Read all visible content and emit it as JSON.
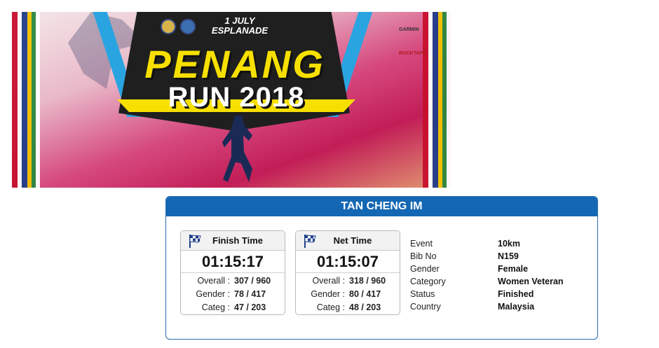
{
  "banner": {
    "date_line1": "1 JULY",
    "date_line2": "ESPLANADE",
    "title_line1": "PENANG",
    "title_line2": "RUN 2018",
    "sponsor_garmin": "GARMIN",
    "sponsor_rocktape": "ROCKTAPE"
  },
  "card": {
    "participant_name": "TAN CHENG IM",
    "finish": {
      "title": "Finish Time",
      "time": "01:15:17",
      "overall_label": "Overall :",
      "overall_value": "307 / 960",
      "gender_label": "Gender :",
      "gender_value": "78 / 417",
      "categ_label": "Categ :",
      "categ_value": "47 / 203"
    },
    "net": {
      "title": "Net Time",
      "time": "01:15:07",
      "overall_label": "Overall :",
      "overall_value": "318 / 960",
      "gender_label": "Gender :",
      "gender_value": "80 / 417",
      "categ_label": "Categ :",
      "categ_value": "48 / 203"
    },
    "info": [
      {
        "label": "Event",
        "value": "10km"
      },
      {
        "label": "Bib No",
        "value": "N159"
      },
      {
        "label": "Gender",
        "value": "Female"
      },
      {
        "label": "Category",
        "value": "Women Veteran"
      },
      {
        "label": "Status",
        "value": "Finished"
      },
      {
        "label": "Country",
        "value": "Malaysia"
      }
    ]
  },
  "colors": {
    "header_blue": "#1467b3",
    "banner_yellow": "#f7e000"
  },
  "icons": {
    "time_box_icon": "checkered-flag-icon"
  }
}
